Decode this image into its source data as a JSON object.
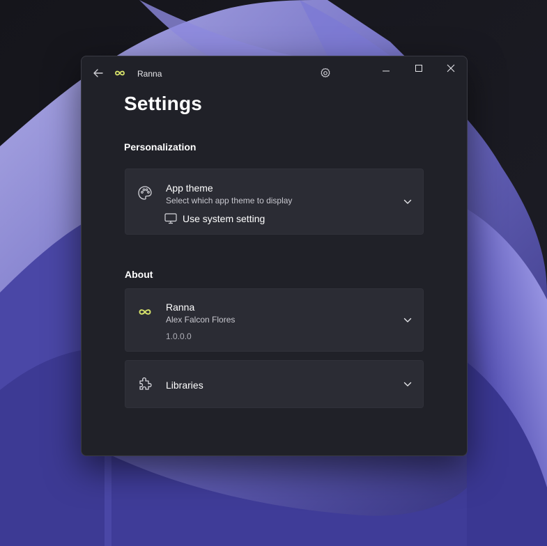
{
  "window": {
    "title": "Ranna",
    "icons": {
      "back": "back-arrow-icon",
      "logo": "infinity-logo-icon",
      "settings": "gear-icon",
      "minimize": "minimize-icon",
      "maximize": "maximize-icon",
      "close": "close-icon"
    }
  },
  "page": {
    "title": "Settings"
  },
  "personalization": {
    "header": "Personalization",
    "app_theme": {
      "title": "App theme",
      "subtitle": "Select which app theme to display",
      "selected": "Use system setting",
      "icon": "palette-icon",
      "selected_icon": "monitor-icon"
    }
  },
  "about": {
    "header": "About",
    "app": {
      "name": "Ranna",
      "author": "Alex Falcon Flores",
      "version": "1.0.0.0",
      "icon": "infinity-logo-icon"
    },
    "libraries": {
      "title": "Libraries",
      "icon": "puzzle-icon"
    }
  },
  "colors": {
    "accent_logo": "#d7e36b",
    "window_bg": "#202128",
    "card_bg": "#2b2c34",
    "wallpaper_purple": "#6f6cc8"
  }
}
